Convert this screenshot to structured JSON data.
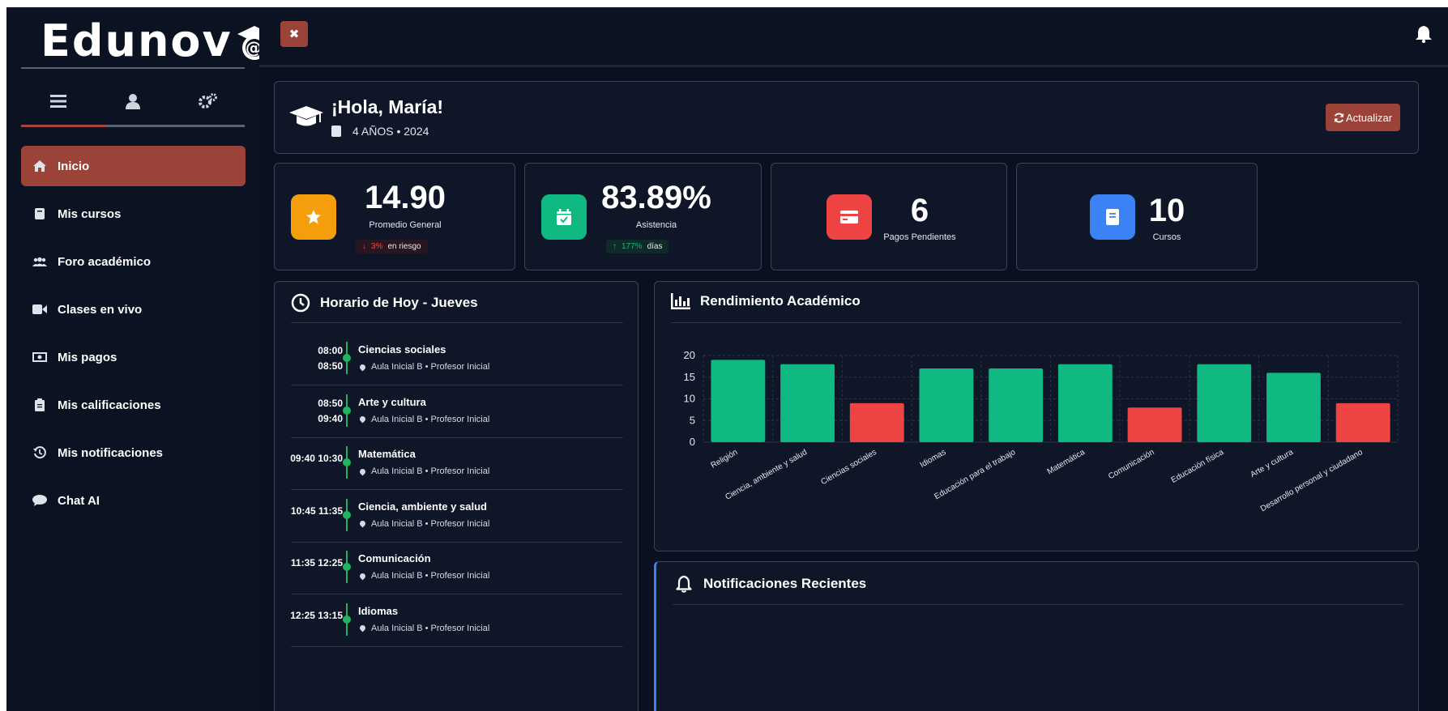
{
  "brand": {
    "name": "Edunov"
  },
  "sidebar": {
    "tabs": [
      "menu",
      "user",
      "settings"
    ],
    "items": [
      {
        "label": "Inicio",
        "icon": "home-icon",
        "active": true
      },
      {
        "label": "Mis cursos",
        "icon": "book-icon",
        "active": false
      },
      {
        "label": "Foro académico",
        "icon": "users-icon",
        "active": false
      },
      {
        "label": "Clases en vivo",
        "icon": "video-icon",
        "active": false
      },
      {
        "label": "Mis pagos",
        "icon": "money-icon",
        "active": false
      },
      {
        "label": "Mis calificaciones",
        "icon": "clipboard-icon",
        "active": false
      },
      {
        "label": "Mis notificaciones",
        "icon": "history-icon",
        "active": false
      },
      {
        "label": "Chat AI",
        "icon": "chat-icon",
        "active": false
      }
    ]
  },
  "topbar": {
    "close_label": "✖"
  },
  "welcome": {
    "greeting": "¡Hola, María!",
    "subtitle": "4 AÑOS • 2024",
    "refresh_label": "Actualizar"
  },
  "stats": [
    {
      "value": "14.90",
      "label": "Promedio General",
      "trend_pct": "3%",
      "trend_text": "en riesgo",
      "trend": "down",
      "color": "#f59e0b",
      "icon": "star-icon"
    },
    {
      "value": "83.89%",
      "label": "Asistencia",
      "trend_pct": "177%",
      "trend_text": "días",
      "trend": "up",
      "color": "#10b981",
      "icon": "calendar-check-icon"
    },
    {
      "value": "6",
      "label": "Pagos Pendientes",
      "color": "#ef4444",
      "icon": "credit-card-icon"
    },
    {
      "value": "10",
      "label": "Cursos",
      "color": "#3b82f6",
      "icon": "book-icon"
    }
  ],
  "schedule": {
    "title": "Horario de Hoy - Jueves",
    "items": [
      {
        "start": "08:00",
        "end": "08:50",
        "course": "Ciencias sociales",
        "room": "Aula Inicial B • Profesor Inicial",
        "stacked": true
      },
      {
        "start": "08:50",
        "end": "09:40",
        "course": "Arte y cultura",
        "room": "Aula Inicial B • Profesor Inicial",
        "stacked": true
      },
      {
        "start": "09:40",
        "end": "10:30",
        "course": "Matemática",
        "room": "Aula Inicial B • Profesor Inicial",
        "stacked": false
      },
      {
        "start": "10:45",
        "end": "11:35",
        "course": "Ciencia, ambiente y salud",
        "room": "Aula Inicial B • Profesor Inicial",
        "stacked": false
      },
      {
        "start": "11:35",
        "end": "12:25",
        "course": "Comunicación",
        "room": "Aula Inicial B • Profesor Inicial",
        "stacked": false
      },
      {
        "start": "12:25",
        "end": "13:15",
        "course": "Idiomas",
        "room": "Aula Inicial B • Profesor Inicial",
        "stacked": false
      }
    ]
  },
  "performance": {
    "title": "Rendimiento Académico"
  },
  "notifications": {
    "title": "Notificaciones Recientes"
  },
  "chart_data": {
    "type": "bar",
    "title": "",
    "xlabel": "",
    "ylabel": "",
    "ylim": [
      0,
      20
    ],
    "yticks": [
      0,
      5,
      10,
      15,
      20
    ],
    "grid": true,
    "categories": [
      "Religión",
      "Ciencia, ambiente y salud",
      "Ciencias sociales",
      "Idiomas",
      "Educación para el trabajo",
      "Matemática",
      "Comunicación",
      "Educación física",
      "Arte y cultura",
      "Desarrollo personal y ciudadano"
    ],
    "values": [
      19,
      18,
      9,
      17,
      17,
      18,
      8,
      18,
      16,
      9
    ],
    "colors": {
      "pass": "#10b981",
      "fail": "#ef4444"
    },
    "threshold": 11
  }
}
